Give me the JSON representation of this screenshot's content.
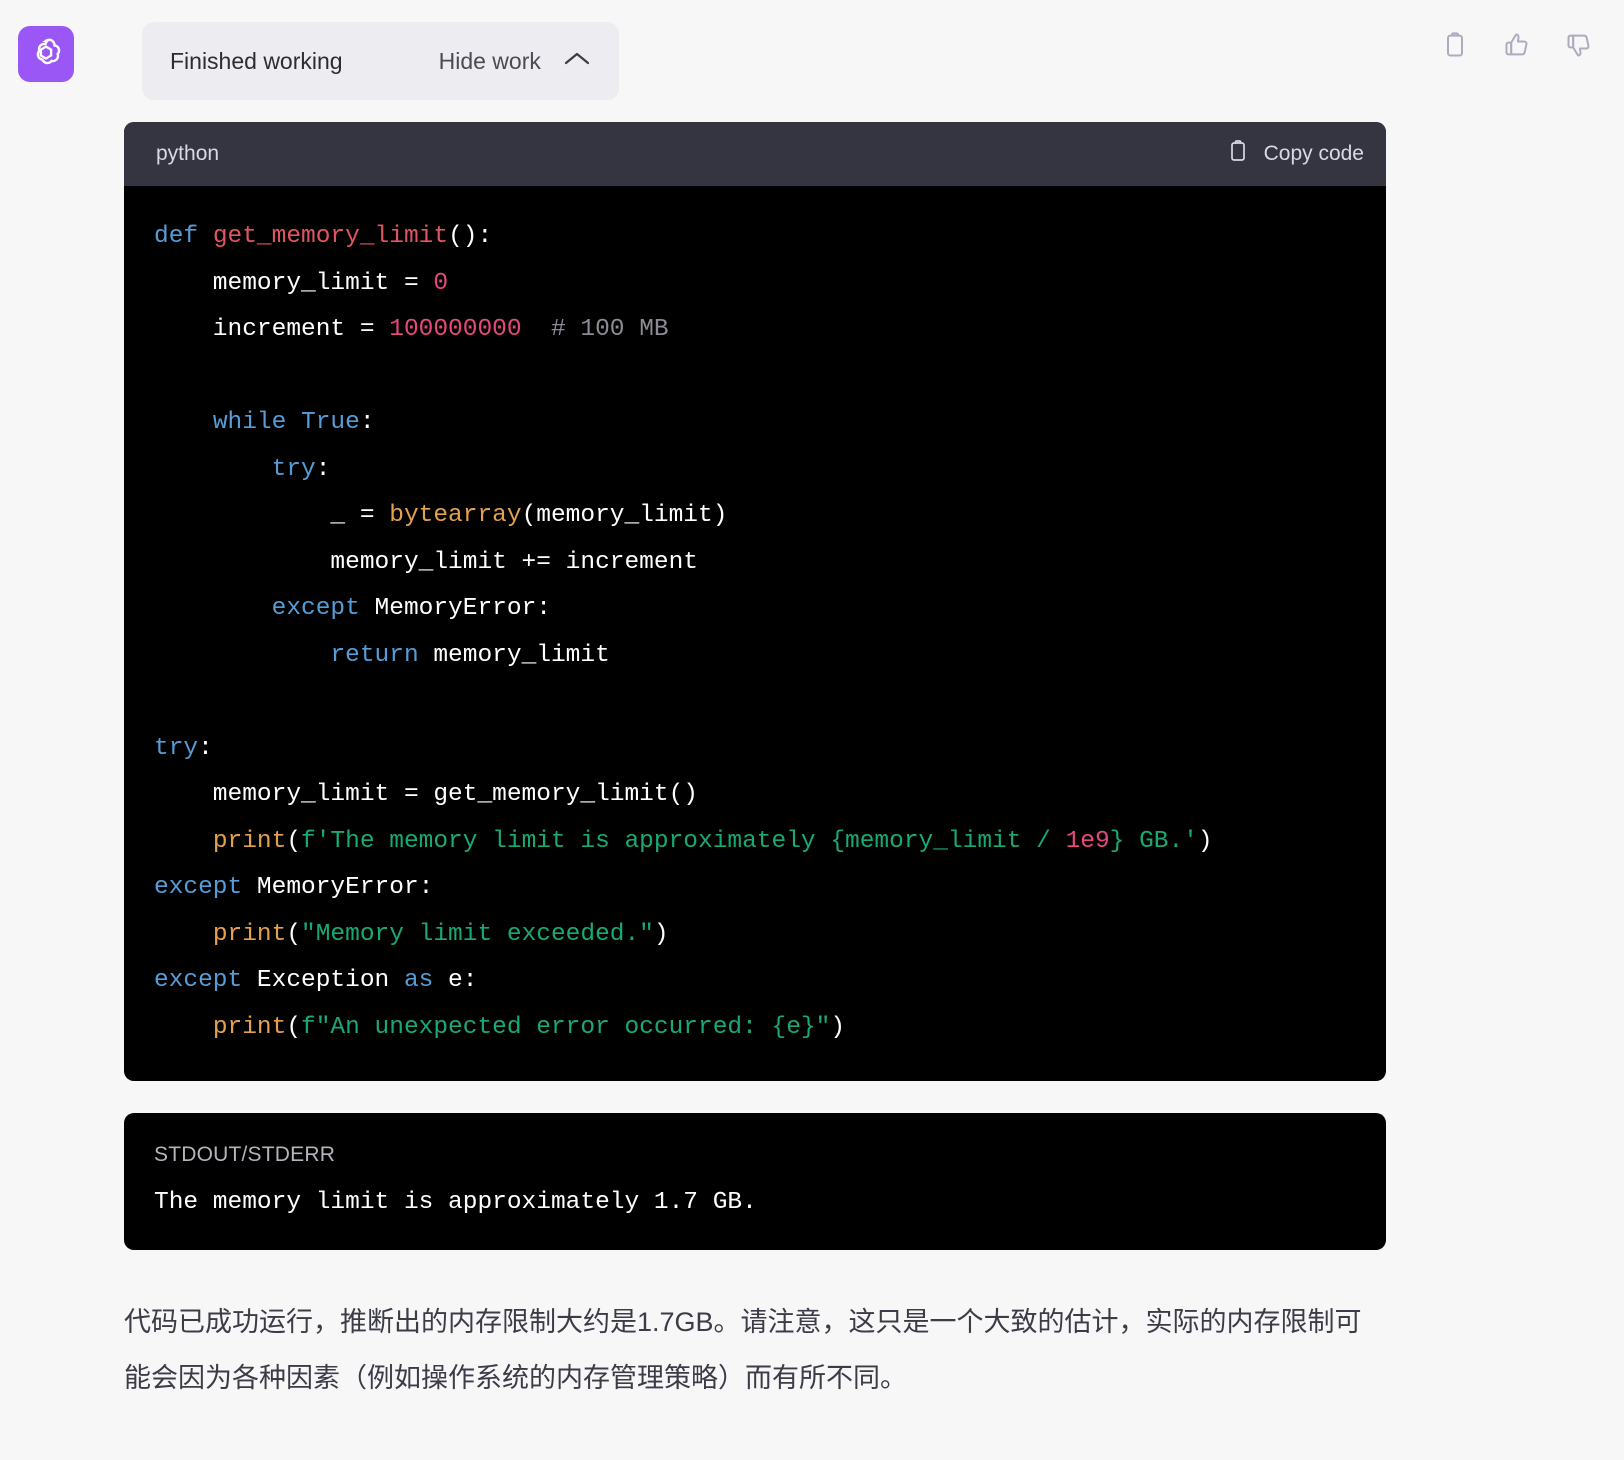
{
  "header": {
    "avatar_icon": "openai-logo-icon",
    "status_label": "Finished working",
    "toggle_label": "Hide work",
    "toggle_icon": "chevron-up-icon",
    "actions": [
      {
        "name": "copy-icon",
        "label": "Copy"
      },
      {
        "name": "thumbs-up-icon",
        "label": "Good response"
      },
      {
        "name": "thumbs-down-icon",
        "label": "Bad response"
      }
    ]
  },
  "code_block": {
    "language": "python",
    "copy_label": "Copy code",
    "copy_icon": "clipboard-icon",
    "lines": [
      [
        {
          "t": "def",
          "c": "kw"
        },
        {
          "t": " ",
          "c": "pl"
        },
        {
          "t": "get_memory_limit",
          "c": "fn"
        },
        {
          "t": "():",
          "c": "pl"
        }
      ],
      [
        {
          "t": "    memory_limit = ",
          "c": "pl"
        },
        {
          "t": "0",
          "c": "num"
        }
      ],
      [
        {
          "t": "    increment = ",
          "c": "pl"
        },
        {
          "t": "100000000",
          "c": "num"
        },
        {
          "t": "  ",
          "c": "pl"
        },
        {
          "t": "# 100 MB",
          "c": "com"
        }
      ],
      [],
      [
        {
          "t": "    ",
          "c": "pl"
        },
        {
          "t": "while",
          "c": "kw"
        },
        {
          "t": " ",
          "c": "pl"
        },
        {
          "t": "True",
          "c": "kw"
        },
        {
          "t": ":",
          "c": "pl"
        }
      ],
      [
        {
          "t": "        ",
          "c": "pl"
        },
        {
          "t": "try",
          "c": "kw"
        },
        {
          "t": ":",
          "c": "pl"
        }
      ],
      [
        {
          "t": "            _ = ",
          "c": "pl"
        },
        {
          "t": "bytearray",
          "c": "bi"
        },
        {
          "t": "(memory_limit)",
          "c": "pl"
        }
      ],
      [
        {
          "t": "            memory_limit += increment",
          "c": "pl"
        }
      ],
      [
        {
          "t": "        ",
          "c": "pl"
        },
        {
          "t": "except",
          "c": "kw"
        },
        {
          "t": " MemoryError:",
          "c": "pl"
        }
      ],
      [
        {
          "t": "            ",
          "c": "pl"
        },
        {
          "t": "return",
          "c": "kw"
        },
        {
          "t": " memory_limit",
          "c": "pl"
        }
      ],
      [],
      [
        {
          "t": "try",
          "c": "kw"
        },
        {
          "t": ":",
          "c": "pl"
        }
      ],
      [
        {
          "t": "    memory_limit = get_memory_limit()",
          "c": "pl"
        }
      ],
      [
        {
          "t": "    ",
          "c": "pl"
        },
        {
          "t": "print",
          "c": "bi"
        },
        {
          "t": "(",
          "c": "pl"
        },
        {
          "t": "f'The memory limit is approximately {memory_limit / ",
          "c": "str"
        },
        {
          "t": "1e9",
          "c": "num"
        },
        {
          "t": "} GB.'",
          "c": "str"
        },
        {
          "t": ")",
          "c": "pl"
        }
      ],
      [
        {
          "t": "except",
          "c": "kw"
        },
        {
          "t": " MemoryError:",
          "c": "pl"
        }
      ],
      [
        {
          "t": "    ",
          "c": "pl"
        },
        {
          "t": "print",
          "c": "bi"
        },
        {
          "t": "(",
          "c": "pl"
        },
        {
          "t": "\"Memory limit exceeded.\"",
          "c": "str"
        },
        {
          "t": ")",
          "c": "pl"
        }
      ],
      [
        {
          "t": "except",
          "c": "kw"
        },
        {
          "t": " Exception ",
          "c": "pl"
        },
        {
          "t": "as",
          "c": "kw"
        },
        {
          "t": " e:",
          "c": "pl"
        }
      ],
      [
        {
          "t": "    ",
          "c": "pl"
        },
        {
          "t": "print",
          "c": "bi"
        },
        {
          "t": "(",
          "c": "pl"
        },
        {
          "t": "f\"An unexpected error occurred: {e}\"",
          "c": "str"
        },
        {
          "t": ")",
          "c": "pl"
        }
      ]
    ]
  },
  "stdout_block": {
    "title": "STDOUT/STDERR",
    "text": "The memory limit is approximately 1.7 GB."
  },
  "answer": {
    "paragraph": "代码已成功运行，推断出的内存限制大约是1.7GB。请注意，这只是一个大致的估计，实际的内存限制可能会因为各种因素（例如操作系统的内存管理策略）而有所不同。"
  },
  "colors": {
    "page_bg": "#f7f7f8",
    "avatar_bg": "#9b57f5",
    "pill_bg": "#ececf1",
    "code_header_bg": "#343541",
    "code_bg": "#000000",
    "keyword": "#569cd6",
    "function": "#e05561",
    "number": "#e5487f",
    "comment": "#8b8b94",
    "builtin": "#e5a04c",
    "string": "#19a974"
  }
}
